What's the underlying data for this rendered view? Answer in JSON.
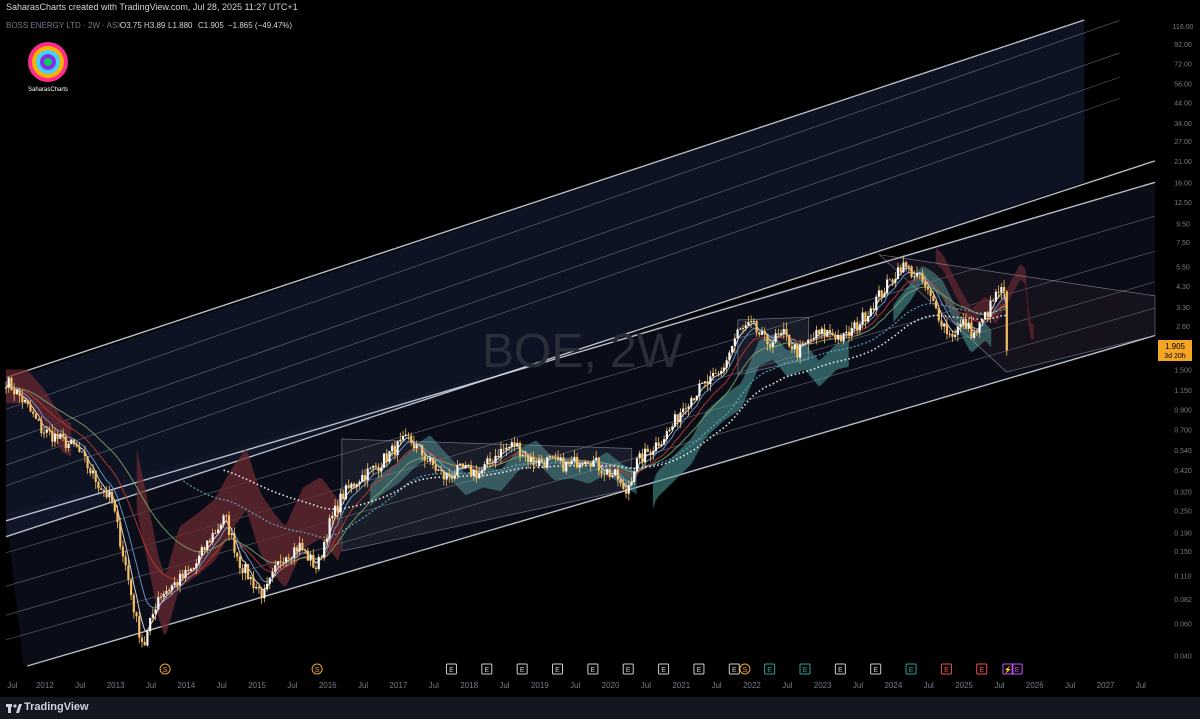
{
  "header": {
    "attribution": "SaharasCharts created with TradingView.com, Jul 28, 2025 11:27 UTC+1"
  },
  "symbol_bar": {
    "name": "BOSS ENERGY LTD · 2W · ASX",
    "open": "O3.75",
    "high": "H3.89",
    "low": "L1.880",
    "close": "C1.905",
    "change": "−1.865 (−49.47%)"
  },
  "logo": {
    "caption": "SaharasCharts"
  },
  "watermark": "BOE, 2W",
  "price_tag": {
    "price": "1.905",
    "countdown": "3d 20h",
    "color": "#f5a623"
  },
  "footer": {
    "brand": "TradingView"
  },
  "colors": {
    "background": "#000000",
    "candle": "#f5c063",
    "channel": "#d8dde8",
    "ema_white": "#e8e8e8",
    "ema_blue": "#6f9bd1",
    "ema_red": "#c0392b",
    "ema_green": "#7aa56a",
    "dotted_ma": "#ffffff",
    "dotted_blue": "#5fb0c8",
    "cloud_bull": "#4f9e9a",
    "cloud_bear": "#6b2a31",
    "earnings_e": "#cfcfcf",
    "earnings_teal": "#26a69a",
    "earnings_red": "#ef5350",
    "split_s": "#f5a623",
    "dividend_purple": "#c850ff"
  },
  "chart_data": {
    "type": "line",
    "title": "BOE, 2W",
    "xlabel": "",
    "ylabel": "",
    "y_scale": "log",
    "ylim": [
      0.035,
      125
    ],
    "xlim": [
      2011.45,
      2027.7
    ],
    "grid": false,
    "y_ticks": [
      "116.00",
      "92.00",
      "72.00",
      "56.00",
      "44.00",
      "34.00",
      "27.00",
      "21.00",
      "16.00",
      "12.50",
      "9.50",
      "7.50",
      "5.50",
      "4.30",
      "3.30",
      "2.60",
      "2.000",
      "1.500",
      "1.150",
      "0.900",
      "0.700",
      "0.540",
      "0.420",
      "0.320",
      "0.250",
      "0.190",
      "0.150",
      "0.110",
      "0.082",
      "0.060",
      "0.040"
    ],
    "y_tick_values": [
      116,
      92,
      72,
      56,
      44,
      34,
      27,
      21,
      16,
      12.5,
      9.5,
      7.5,
      5.5,
      4.3,
      3.3,
      2.6,
      2.0,
      1.5,
      1.15,
      0.9,
      0.7,
      0.54,
      0.42,
      0.32,
      0.25,
      0.19,
      0.15,
      0.11,
      0.082,
      0.06,
      0.04
    ],
    "x_ticks": [
      {
        "label": "Jul",
        "x": 2011.54
      },
      {
        "label": "2012",
        "x": 2012.0
      },
      {
        "label": "Jul",
        "x": 2012.5
      },
      {
        "label": "2013",
        "x": 2013.0
      },
      {
        "label": "Jul",
        "x": 2013.5
      },
      {
        "label": "2014",
        "x": 2014.0
      },
      {
        "label": "Jul",
        "x": 2014.5
      },
      {
        "label": "2015",
        "x": 2015.0
      },
      {
        "label": "Jul",
        "x": 2015.5
      },
      {
        "label": "2016",
        "x": 2016.0
      },
      {
        "label": "Jul",
        "x": 2016.5
      },
      {
        "label": "2017",
        "x": 2017.0
      },
      {
        "label": "Jul",
        "x": 2017.5
      },
      {
        "label": "2018",
        "x": 2018.0
      },
      {
        "label": "Jul",
        "x": 2018.5
      },
      {
        "label": "2019",
        "x": 2019.0
      },
      {
        "label": "Jul",
        "x": 2019.5
      },
      {
        "label": "2020",
        "x": 2020.0
      },
      {
        "label": "Jul",
        "x": 2020.5
      },
      {
        "label": "2021",
        "x": 2021.0
      },
      {
        "label": "Jul",
        "x": 2021.5
      },
      {
        "label": "2022",
        "x": 2022.0
      },
      {
        "label": "Jul",
        "x": 2022.5
      },
      {
        "label": "2023",
        "x": 2023.0
      },
      {
        "label": "Jul",
        "x": 2023.5
      },
      {
        "label": "2024",
        "x": 2024.0
      },
      {
        "label": "Jul",
        "x": 2024.5
      },
      {
        "label": "2025",
        "x": 2025.0
      },
      {
        "label": "Jul",
        "x": 2025.5
      },
      {
        "label": "2026",
        "x": 2026.0
      },
      {
        "label": "Jul",
        "x": 2026.5
      },
      {
        "label": "2027",
        "x": 2027.0
      },
      {
        "label": "Jul",
        "x": 2027.5
      }
    ],
    "series": [
      {
        "values": [
          [
            2011.45,
            1.3
          ],
          [
            2011.7,
            1.0
          ],
          [
            2011.95,
            0.7
          ],
          [
            2012.2,
            0.62
          ],
          [
            2012.45,
            0.55
          ],
          [
            2012.7,
            0.38
          ],
          [
            2012.95,
            0.28
          ],
          [
            2013.15,
            0.12
          ],
          [
            2013.3,
            0.06
          ],
          [
            2013.4,
            0.045
          ],
          [
            2013.6,
            0.085
          ],
          [
            2013.85,
            0.1
          ],
          [
            2014.1,
            0.12
          ],
          [
            2014.35,
            0.18
          ],
          [
            2014.55,
            0.23
          ],
          [
            2014.75,
            0.13
          ],
          [
            2014.95,
            0.1
          ],
          [
            2015.1,
            0.085
          ],
          [
            2015.35,
            0.14
          ],
          [
            2015.6,
            0.16
          ],
          [
            2015.85,
            0.12
          ],
          [
            2016.0,
            0.2
          ],
          [
            2016.2,
            0.3
          ],
          [
            2016.45,
            0.38
          ],
          [
            2016.7,
            0.44
          ],
          [
            2016.95,
            0.55
          ],
          [
            2017.15,
            0.62
          ],
          [
            2017.4,
            0.48
          ],
          [
            2017.65,
            0.38
          ],
          [
            2017.9,
            0.42
          ],
          [
            2018.15,
            0.4
          ],
          [
            2018.4,
            0.52
          ],
          [
            2018.65,
            0.58
          ],
          [
            2018.9,
            0.46
          ],
          [
            2019.15,
            0.47
          ],
          [
            2019.4,
            0.44
          ],
          [
            2019.65,
            0.5
          ],
          [
            2019.9,
            0.42
          ],
          [
            2020.1,
            0.38
          ],
          [
            2020.2,
            0.3
          ],
          [
            2020.35,
            0.45
          ],
          [
            2020.6,
            0.56
          ],
          [
            2020.85,
            0.7
          ],
          [
            2021.05,
            0.98
          ],
          [
            2021.3,
            1.2
          ],
          [
            2021.55,
            1.4
          ],
          [
            2021.8,
            2.4
          ],
          [
            2022.0,
            2.6
          ],
          [
            2022.2,
            2.1
          ],
          [
            2022.45,
            2.3
          ],
          [
            2022.65,
            1.85
          ],
          [
            2022.9,
            2.3
          ],
          [
            2023.1,
            2.4
          ],
          [
            2023.3,
            2.2
          ],
          [
            2023.55,
            2.8
          ],
          [
            2023.75,
            3.6
          ],
          [
            2023.95,
            4.5
          ],
          [
            2024.1,
            5.6
          ],
          [
            2024.25,
            5.2
          ],
          [
            2024.4,
            4.6
          ],
          [
            2024.6,
            3.2
          ],
          [
            2024.8,
            2.3
          ],
          [
            2025.0,
            2.7
          ],
          [
            2025.15,
            2.3
          ],
          [
            2025.35,
            3.2
          ],
          [
            2025.5,
            4.1
          ],
          [
            2025.58,
            3.75
          ],
          [
            2025.62,
            1.905
          ]
        ]
      }
    ],
    "events": [
      {
        "label": "S",
        "x": 2013.7,
        "color": "#f5a623"
      },
      {
        "label": "S",
        "x": 2015.85,
        "color": "#f5a623"
      },
      {
        "label": "E",
        "x": 2017.75,
        "color": "#cfcfcf"
      },
      {
        "label": "E",
        "x": 2018.25,
        "color": "#cfcfcf"
      },
      {
        "label": "E",
        "x": 2018.75,
        "color": "#cfcfcf"
      },
      {
        "label": "E",
        "x": 2019.25,
        "color": "#cfcfcf"
      },
      {
        "label": "E",
        "x": 2019.75,
        "color": "#cfcfcf"
      },
      {
        "label": "E",
        "x": 2020.25,
        "color": "#cfcfcf"
      },
      {
        "label": "E",
        "x": 2020.75,
        "color": "#cfcfcf"
      },
      {
        "label": "E",
        "x": 2021.25,
        "color": "#cfcfcf"
      },
      {
        "label": "E",
        "x": 2021.75,
        "color": "#cfcfcf"
      },
      {
        "label": "S",
        "x": 2021.9,
        "color": "#f5a623"
      },
      {
        "label": "E",
        "x": 2022.25,
        "color": "#26a69a"
      },
      {
        "label": "E",
        "x": 2022.75,
        "color": "#26a69a"
      },
      {
        "label": "E",
        "x": 2023.25,
        "color": "#cfcfcf"
      },
      {
        "label": "E",
        "x": 2023.75,
        "color": "#cfcfcf"
      },
      {
        "label": "E",
        "x": 2024.25,
        "color": "#26a69a"
      },
      {
        "label": "E",
        "x": 2024.75,
        "color": "#ef5350"
      },
      {
        "label": "E",
        "x": 2025.25,
        "color": "#ef5350"
      },
      {
        "label": "⚡",
        "x": 2025.62,
        "color": "#c850ff"
      },
      {
        "label": "E",
        "x": 2025.75,
        "color": "#c850ff"
      }
    ]
  }
}
